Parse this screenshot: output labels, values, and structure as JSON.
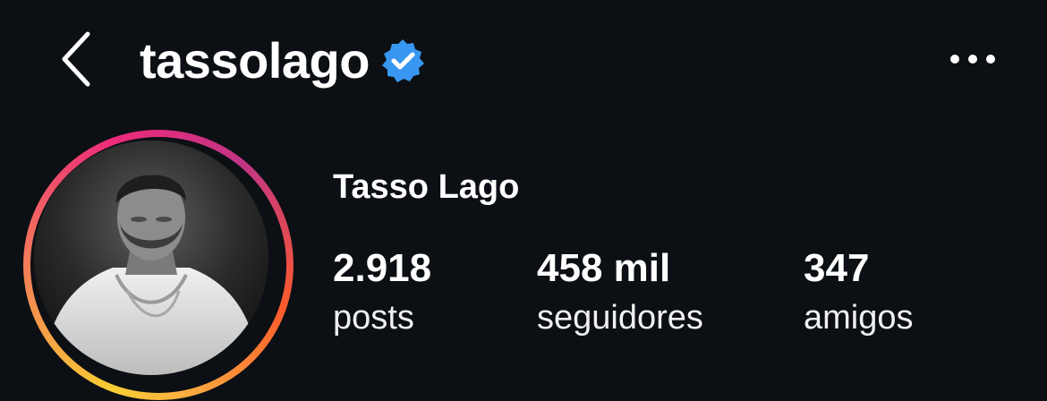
{
  "header": {
    "username": "tassolago",
    "icons": {
      "back": "chevron-left-icon",
      "verified": "verified-badge-icon",
      "more": "more-horizontal-icon"
    },
    "colors": {
      "verified": "#3897f0",
      "background": "#0c0f14"
    }
  },
  "profile": {
    "display_name": "Tasso Lago",
    "stats": {
      "posts": {
        "value": "2.918",
        "label": "posts"
      },
      "followers": {
        "value": "458 mil",
        "label": "seguidores"
      },
      "friends": {
        "value": "347",
        "label": "amigos"
      }
    }
  }
}
